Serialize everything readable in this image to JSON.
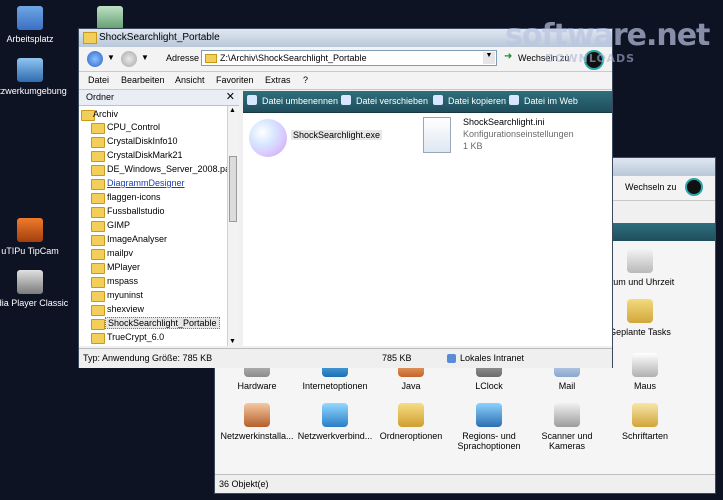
{
  "desktop": {
    "icons": [
      {
        "label": "Arbeitsplatz"
      },
      {
        "label": ""
      },
      {
        "label": "etzwerkumgebung"
      },
      {
        "label": "uTIPu TipCam"
      },
      {
        "label": "edia Player Classic"
      }
    ]
  },
  "watermark": {
    "brand": "software.net",
    "sub": "DOWNLOADS"
  },
  "explorer": {
    "title": "ShockSearchlight_Portable",
    "address_label": "Adresse",
    "address_value": "Z:\\Archiv\\ShockSearchlight_Portable",
    "go_label": "Wechseln zu",
    "menu": [
      "Datei",
      "Bearbeiten",
      "Ansicht",
      "Favoriten",
      "Extras",
      "?"
    ],
    "folders_header": "Ordner",
    "tree": [
      "Archiv",
      "CPU_Control",
      "CrystalDiskInfo10",
      "CrystalDiskMark21",
      "DE_Windows_Server_2008.part",
      "DiagrammDesigner",
      "flaggen-icons",
      "Fussballstudio",
      "GIMP",
      "ImageAnalyser",
      "mailpv",
      "MPlayer",
      "mspass",
      "myuninst",
      "shexview",
      "ShockSearchlight_Portable",
      "TrueCrypt_6.0"
    ],
    "tasks": [
      "Datei umbenennen",
      "Datei verschieben",
      "Datei kopieren",
      "Datei im Web"
    ],
    "files": [
      {
        "name": "ShockSearchlight.exe",
        "meta1": "",
        "meta2": ""
      },
      {
        "name": "ShockSearchlight.ini",
        "meta1": "Konfigurationseinstellungen",
        "meta2": "1 KB"
      }
    ],
    "status_left": "Typ: Anwendung Größe: 785 KB",
    "status_mid": "785 KB",
    "status_right": "Lokales Intranet"
  },
  "control_panel": {
    "go_label": "Wechseln zu",
    "side_labels": [
      "atum und Uhrzeit",
      "Geplante Tasks",
      "Maus"
    ],
    "row1": [
      "Hardware",
      "Internetoptionen",
      "Java",
      "LClock",
      "Mail"
    ],
    "row2": [
      "Netzwerkinstalla...",
      "Netzwerkverbind...",
      "Ordneroptionen",
      "Regions- und Sprachoptionen",
      "Scanner und Kameras",
      "Schriftarten"
    ],
    "status": "36 Objekt(e)"
  }
}
